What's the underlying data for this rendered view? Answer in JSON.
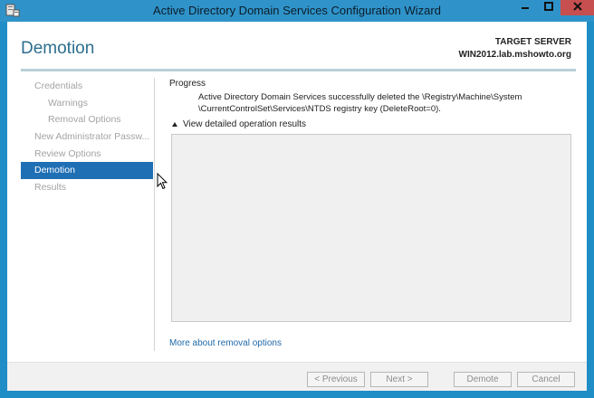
{
  "window": {
    "title": "Active Directory Domain Services Configuration Wizard",
    "app_icon": "server-wizard-icon"
  },
  "header": {
    "page_title": "Demotion",
    "target_label": "TARGET SERVER",
    "target_name": "WIN2012.lab.mshowto.org"
  },
  "nav": {
    "items": [
      {
        "label": "Credentials",
        "sub": false,
        "active": false
      },
      {
        "label": "Warnings",
        "sub": true,
        "active": false
      },
      {
        "label": "Removal Options",
        "sub": true,
        "active": false
      },
      {
        "label": "New Administrator Passw...",
        "sub": false,
        "active": false
      },
      {
        "label": "Review Options",
        "sub": false,
        "active": false
      },
      {
        "label": "Demotion",
        "sub": false,
        "active": true
      },
      {
        "label": "Results",
        "sub": false,
        "active": false
      }
    ]
  },
  "main": {
    "section_label": "Progress",
    "progress_line1": "Active Directory Domain Services successfully deleted the \\Registry\\Machine\\System",
    "progress_line2": "\\CurrentControlSet\\Services\\NTDS registry key (DeleteRoot=0).",
    "details_toggle": "View detailed operation results",
    "more_link": "More about removal options"
  },
  "footer": {
    "previous": "< Previous",
    "next": "Next >",
    "demote": "Demote",
    "cancel": "Cancel"
  },
  "colors": {
    "titlebar": "#2f93c9",
    "active_nav": "#1f6fb5",
    "close_button": "#c74f4f",
    "link": "#1f69a8"
  }
}
